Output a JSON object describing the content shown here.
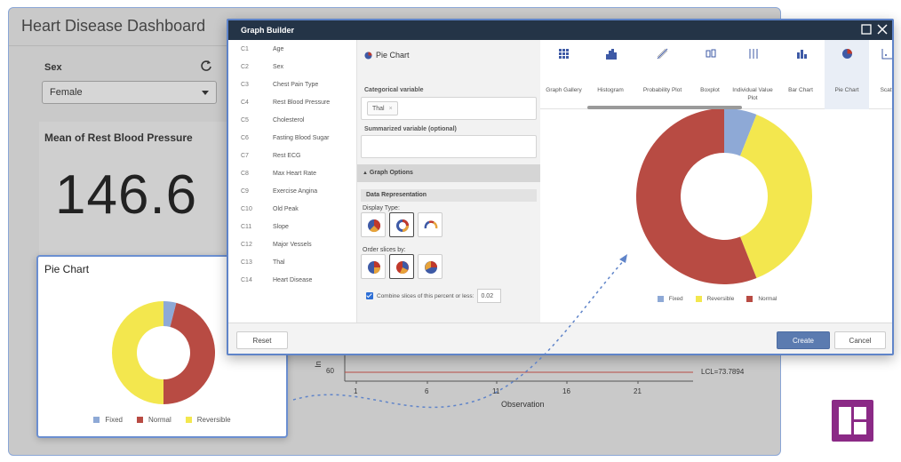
{
  "dashboard": {
    "title": "Heart Disease Dashboard",
    "sex_label": "Sex",
    "sex_value": "Female",
    "mean_card_title": "Mean of Rest Blood Pressure",
    "mean_value": "146.6",
    "pie_card_title": "Pie Chart",
    "pie_legend": [
      {
        "label": "Fixed",
        "color": "#8ea9d6"
      },
      {
        "label": "Normal",
        "color": "#b84b43"
      },
      {
        "label": "Reversible",
        "color": "#f3e74e"
      }
    ],
    "control_chart": {
      "y_label": "In",
      "y_tick": "60",
      "lcl_label": "LCL=73.7894",
      "x_ticks": [
        "1",
        "6",
        "11",
        "16",
        "21"
      ],
      "x_title": "Observation"
    }
  },
  "chart_data": [
    {
      "type": "pie",
      "title": "Pie Chart",
      "categories": [
        "Fixed",
        "Normal",
        "Reversible"
      ],
      "values": [
        0.04,
        0.46,
        0.5
      ],
      "colors": [
        "#8ea9d6",
        "#b84b43",
        "#f3e74e"
      ],
      "donut": true,
      "legend_position": "bottom"
    },
    {
      "type": "pie",
      "categories": [
        "Fixed",
        "Reversible",
        "Normal"
      ],
      "values": [
        0.06,
        0.38,
        0.56
      ],
      "colors": [
        "#8ea9d6",
        "#f3e74e",
        "#b84b43"
      ],
      "donut": true,
      "legend_position": "bottom"
    }
  ],
  "dialog": {
    "title": "Graph Builder",
    "variables": [
      {
        "code": "C1",
        "name": "Age"
      },
      {
        "code": "C2",
        "name": "Sex"
      },
      {
        "code": "C3",
        "name": "Chest Pain Type"
      },
      {
        "code": "C4",
        "name": "Rest Blood Pressure"
      },
      {
        "code": "C5",
        "name": "Cholesterol"
      },
      {
        "code": "C6",
        "name": "Fasting Blood Sugar"
      },
      {
        "code": "C7",
        "name": "Rest ECG"
      },
      {
        "code": "C8",
        "name": "Max Heart Rate"
      },
      {
        "code": "C9",
        "name": "Exercise Angina"
      },
      {
        "code": "C10",
        "name": "Old Peak"
      },
      {
        "code": "C11",
        "name": "Slope"
      },
      {
        "code": "C12",
        "name": "Major Vessels"
      },
      {
        "code": "C13",
        "name": "Thal"
      },
      {
        "code": "C14",
        "name": "Heart Disease"
      }
    ],
    "settings": {
      "title": "Pie Chart",
      "categorical_label": "Categorical variable",
      "categorical_chip": "Thal",
      "chip_remove": "×",
      "summarized_label": "Summarized variable (optional)",
      "graph_options": "Graph Options",
      "data_representation": "Data Representation",
      "display_type": "Display Type:",
      "order_slices": "Order slices by:",
      "combine_label": "Combine slices of this percent or less:",
      "combine_value": "0.02"
    },
    "gallery": [
      {
        "label": "Graph Gallery",
        "icon": "grid-icon"
      },
      {
        "label": "Histogram",
        "icon": "histogram-icon"
      },
      {
        "label": "Probability Plot",
        "icon": "probability-plot-icon"
      },
      {
        "label": "Boxplot",
        "icon": "boxplot-icon"
      },
      {
        "label": "Individual Value Plot",
        "icon": "individual-value-plot-icon"
      },
      {
        "label": "Bar Chart",
        "icon": "bar-chart-icon"
      },
      {
        "label": "Pie Chart",
        "icon": "pie-chart-icon"
      },
      {
        "label": "Scatt",
        "icon": "scatterplot-icon"
      }
    ],
    "preview_legend": [
      {
        "label": "Fixed",
        "color": "#8ea9d6"
      },
      {
        "label": "Reversible",
        "color": "#f3e74e"
      },
      {
        "label": "Normal",
        "color": "#b84b43"
      }
    ],
    "buttons": {
      "reset": "Reset",
      "create": "Create",
      "cancel": "Cancel"
    }
  },
  "colors": {
    "accent": "#5f84c9",
    "titlebar": "#243447",
    "logo": "#8b2a86"
  }
}
